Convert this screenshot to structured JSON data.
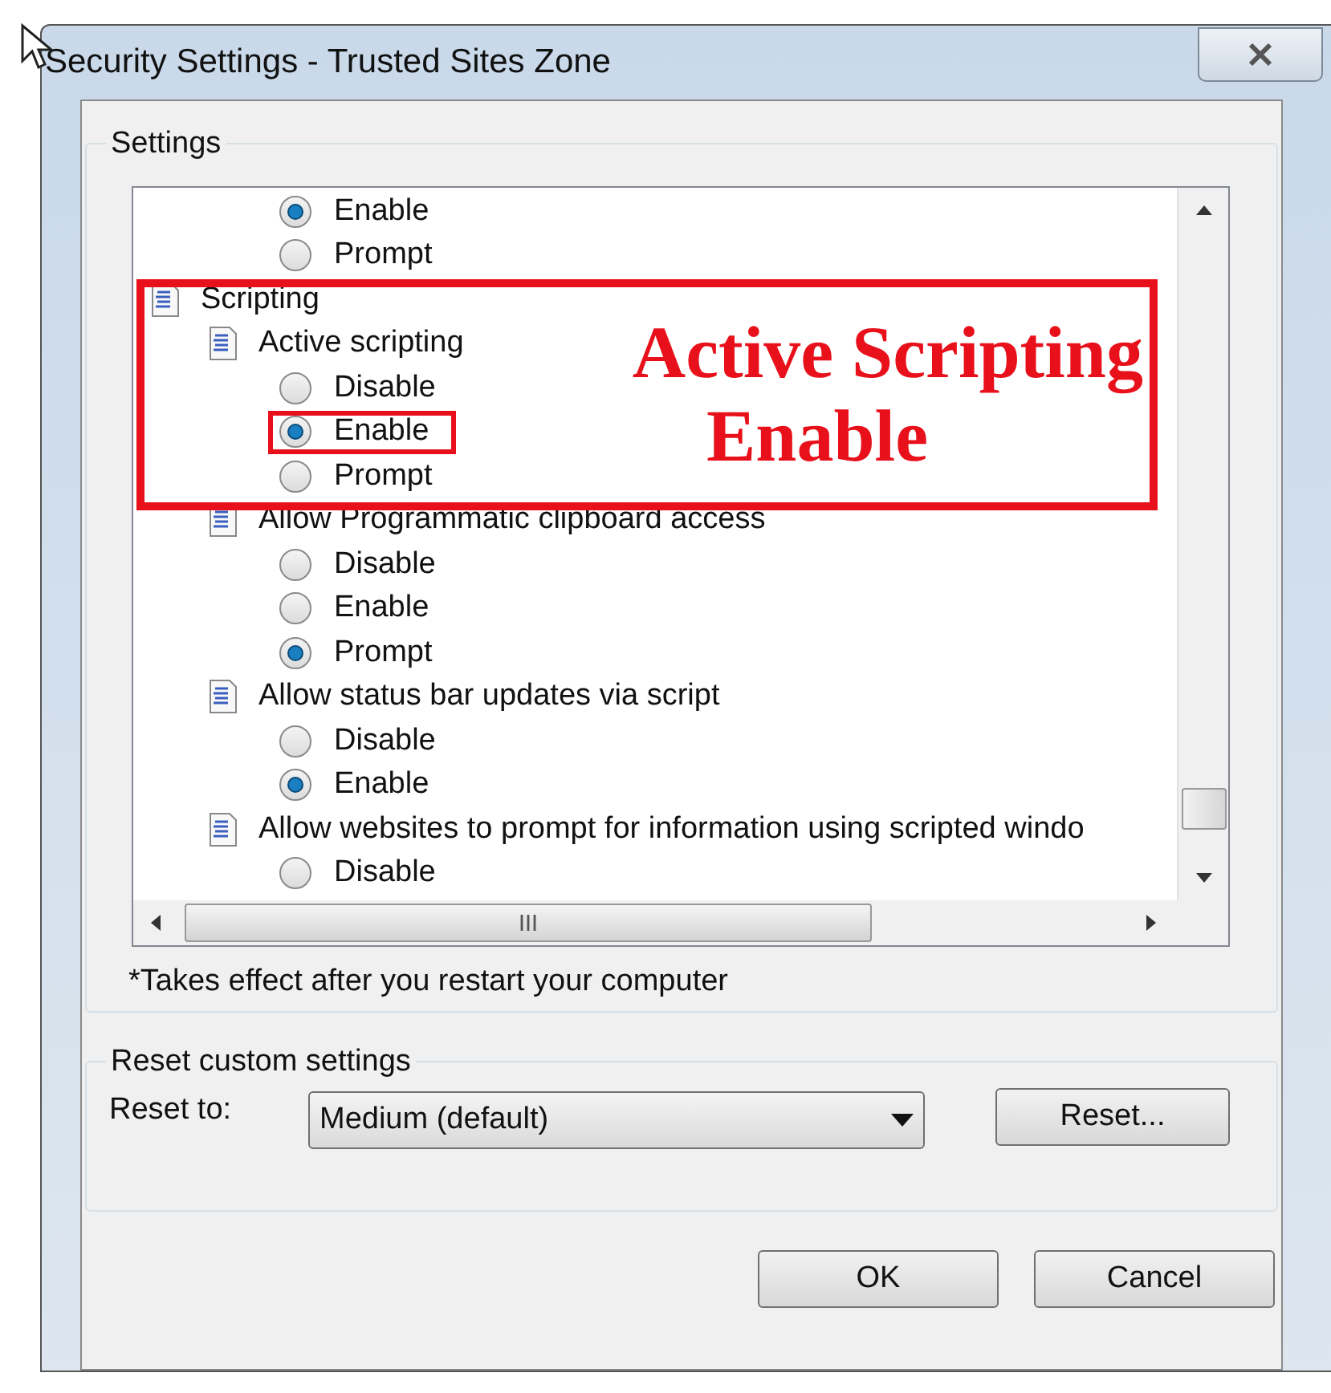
{
  "window": {
    "title": "Security Settings - Trusted Sites Zone"
  },
  "settings": {
    "title": "Settings",
    "tree": [
      {
        "kind": "radio",
        "label": "Enable",
        "selected": true
      },
      {
        "kind": "radio",
        "label": "Prompt",
        "selected": false
      },
      {
        "kind": "group",
        "label": "Scripting",
        "children": [
          {
            "kind": "group",
            "label": "Active scripting",
            "children": [
              {
                "kind": "radio",
                "label": "Disable",
                "selected": false
              },
              {
                "kind": "radio",
                "label": "Enable",
                "selected": true,
                "highlighted": true
              },
              {
                "kind": "radio",
                "label": "Prompt",
                "selected": false
              }
            ]
          },
          {
            "kind": "group",
            "label": "Allow Programmatic clipboard access",
            "children": [
              {
                "kind": "radio",
                "label": "Disable",
                "selected": false
              },
              {
                "kind": "radio",
                "label": "Enable",
                "selected": false
              },
              {
                "kind": "radio",
                "label": "Prompt",
                "selected": true
              }
            ]
          },
          {
            "kind": "group",
            "label": "Allow status bar updates via script",
            "children": [
              {
                "kind": "radio",
                "label": "Disable",
                "selected": false
              },
              {
                "kind": "radio",
                "label": "Enable",
                "selected": true
              }
            ]
          },
          {
            "kind": "group",
            "label": "Allow websites to prompt for information using scripted windo",
            "children": [
              {
                "kind": "radio",
                "label": "Disable",
                "selected": false
              }
            ]
          }
        ]
      }
    ],
    "note": "*Takes effect after you restart your computer"
  },
  "callout": {
    "lines": [
      "Active Scripting",
      "Enable"
    ]
  },
  "reset": {
    "title": "Reset custom settings",
    "label": "Reset to:",
    "value": "Medium (default)",
    "button": "Reset..."
  },
  "buttons": [
    "OK",
    "Cancel"
  ]
}
